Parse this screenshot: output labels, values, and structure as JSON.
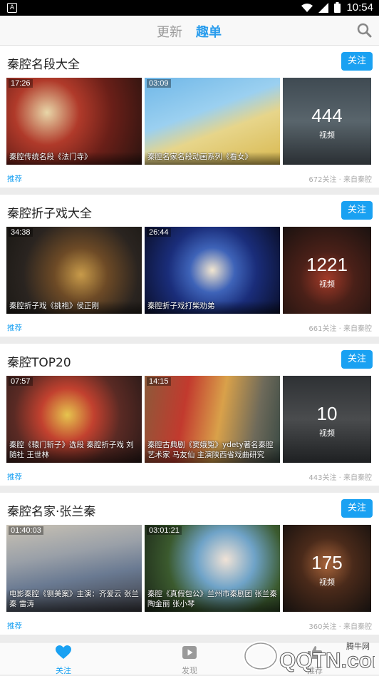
{
  "status_bar": {
    "time": "10:54"
  },
  "header": {
    "tab_update": "更新",
    "tab_qudan": "趣单",
    "icons": {
      "search": "search-icon"
    }
  },
  "colors": {
    "accent": "#1aa1f2"
  },
  "cards": [
    {
      "title": "秦腔名段大全",
      "follow_label": "关注",
      "videos": [
        {
          "duration": "17:26",
          "caption": "秦腔传统名段《法门寺》"
        },
        {
          "duration": "03:09",
          "caption": "秦腔名家名段动画系列《看女》"
        }
      ],
      "count": "444",
      "count_unit": "视频",
      "recommend": "推荐",
      "meta": "672关注 · 来自秦腔"
    },
    {
      "title": "秦腔折子戏大全",
      "follow_label": "关注",
      "videos": [
        {
          "duration": "34:38",
          "caption": "秦腔折子戏《挑袍》侯正刚"
        },
        {
          "duration": "26:44",
          "caption": "秦腔折子戏打柴劝弟"
        }
      ],
      "count": "1221",
      "count_unit": "视频",
      "recommend": "推荐",
      "meta": "661关注 · 来自秦腔"
    },
    {
      "title": "秦腔TOP20",
      "follow_label": "关注",
      "videos": [
        {
          "duration": "07:57",
          "caption": "秦腔《辕门斩子》选段 秦腔折子戏 刘随社 王世林"
        },
        {
          "duration": "14:15",
          "caption": "秦腔古典剧《窦娥冤》ydety著名秦腔艺术家 马友仙 主演陕西省戏曲研究"
        }
      ],
      "count": "10",
      "count_unit": "视频",
      "recommend": "推荐",
      "meta": "443关注 · 来自秦腔"
    },
    {
      "title": "秦腔名家·张兰秦",
      "follow_label": "关注",
      "videos": [
        {
          "duration": "01:40:03",
          "caption": "电影秦腔《铡美案》主演：齐爱云 张兰秦 雷涛"
        },
        {
          "duration": "03:01:21",
          "caption": "秦腔《真假包公》兰州市秦剧团 张兰秦 陶金丽 张小琴"
        }
      ],
      "count": "175",
      "count_unit": "视频",
      "recommend": "推荐",
      "meta": "360关注 · 来自秦腔"
    }
  ],
  "bottom_nav": {
    "follow": {
      "label": "关注",
      "icon": "heart-icon"
    },
    "discover": {
      "label": "发现",
      "icon": "play-icon"
    },
    "recommend": {
      "label": "推荐",
      "icon": "thumbs-icon"
    }
  },
  "watermark": {
    "text": "QQTN.com",
    "subtext": "腾牛网"
  }
}
